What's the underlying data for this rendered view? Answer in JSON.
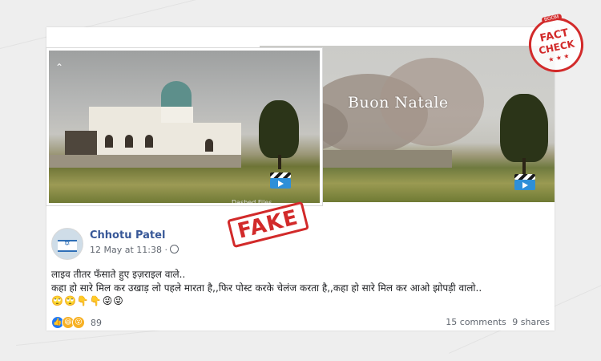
{
  "post": {
    "author": "Chhotu Patel",
    "timestamp": "12 May at 11:38 ·",
    "privacy_icon": "globe-icon",
    "text_line1": "लाइव तीतर फँसाते हुए इज़राइल वाले..",
    "text_line2": "कहा हो सारे मिल कर उखाड़ लो पहले मारता है,,फिर पोस्ट करके चेलंज करता है,,कहा हो सारे मिल कर आओ झोपड़ी वालो..",
    "emojis": "🙄🙄👇👇😜😜"
  },
  "media": {
    "right_overlay_text": "Buon Natale",
    "left_watermark": "Dashed Files",
    "video_icon": "clapperboard-icon"
  },
  "stamps": {
    "fake_label": "FAKE",
    "fact_check_line1": "FACT",
    "fact_check_line2": "CHECK",
    "fact_check_tag": "BOOM",
    "fact_check_stars": "★ ★ ★"
  },
  "reactions": {
    "count": "89",
    "types": [
      "like",
      "haha",
      "wow"
    ],
    "comments": "15 comments",
    "shares": "9 shares"
  },
  "colors": {
    "name_link": "#385898",
    "stamp_red": "#d22a2a",
    "like_blue": "#2078f4"
  }
}
